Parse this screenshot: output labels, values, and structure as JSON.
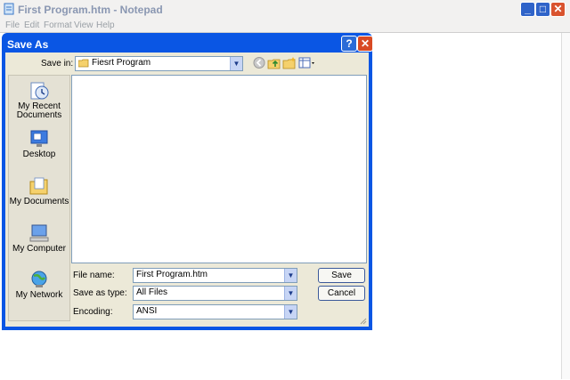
{
  "notepad": {
    "title": "First Program.htm - Notepad",
    "menu": [
      "File",
      "Edit",
      "Format",
      "View",
      "Help"
    ],
    "controls": {
      "minimize": "_",
      "maximize": "□",
      "close": "✕"
    }
  },
  "dialog": {
    "title": "Save As",
    "help_label": "?",
    "close_label": "✕",
    "save_in_label": "Save in:",
    "save_in_value": "Fiesrt Program",
    "places": [
      "My Recent Documents",
      "Desktop",
      "My Documents",
      "My Computer",
      "My Network"
    ],
    "file_name_label": "File name:",
    "file_name_value": "First Program.htm",
    "save_as_type_label": "Save as type:",
    "save_as_type_value": "All Files",
    "encoding_label": "Encoding:",
    "encoding_value": "ANSI",
    "save_button": "Save",
    "cancel_button": "Cancel"
  },
  "colors": {
    "xp_blue": "#0a56e4",
    "dialog_face": "#ece9d8",
    "close_red": "#d84a24"
  }
}
